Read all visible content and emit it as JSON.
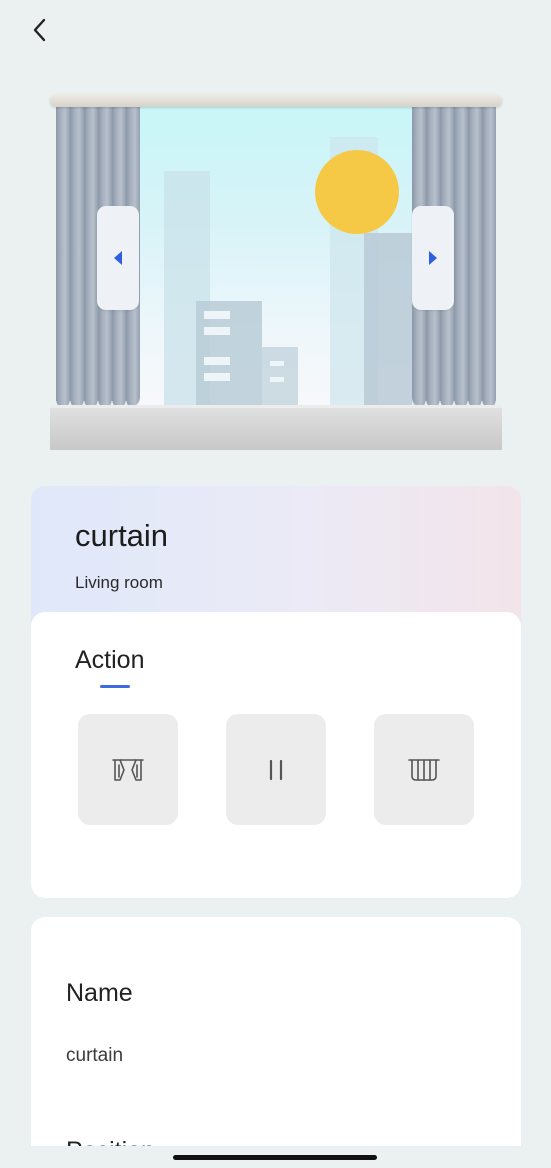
{
  "header": {
    "back_icon": "chevron-left-icon"
  },
  "illustration": {
    "left_arrow_icon": "triangle-left-icon",
    "right_arrow_icon": "triangle-right-icon",
    "sun_color": "#f5c945",
    "accent_color": "#3e6be0"
  },
  "device": {
    "name": "curtain",
    "room": "Living room"
  },
  "action": {
    "title": "Action",
    "buttons": [
      {
        "name": "open",
        "icon": "curtain-open-icon"
      },
      {
        "name": "pause",
        "icon": "pause-icon"
      },
      {
        "name": "close",
        "icon": "curtain-close-icon"
      }
    ]
  },
  "settings": {
    "name_label": "Name",
    "name_value": "curtain",
    "position_label": "Position"
  }
}
